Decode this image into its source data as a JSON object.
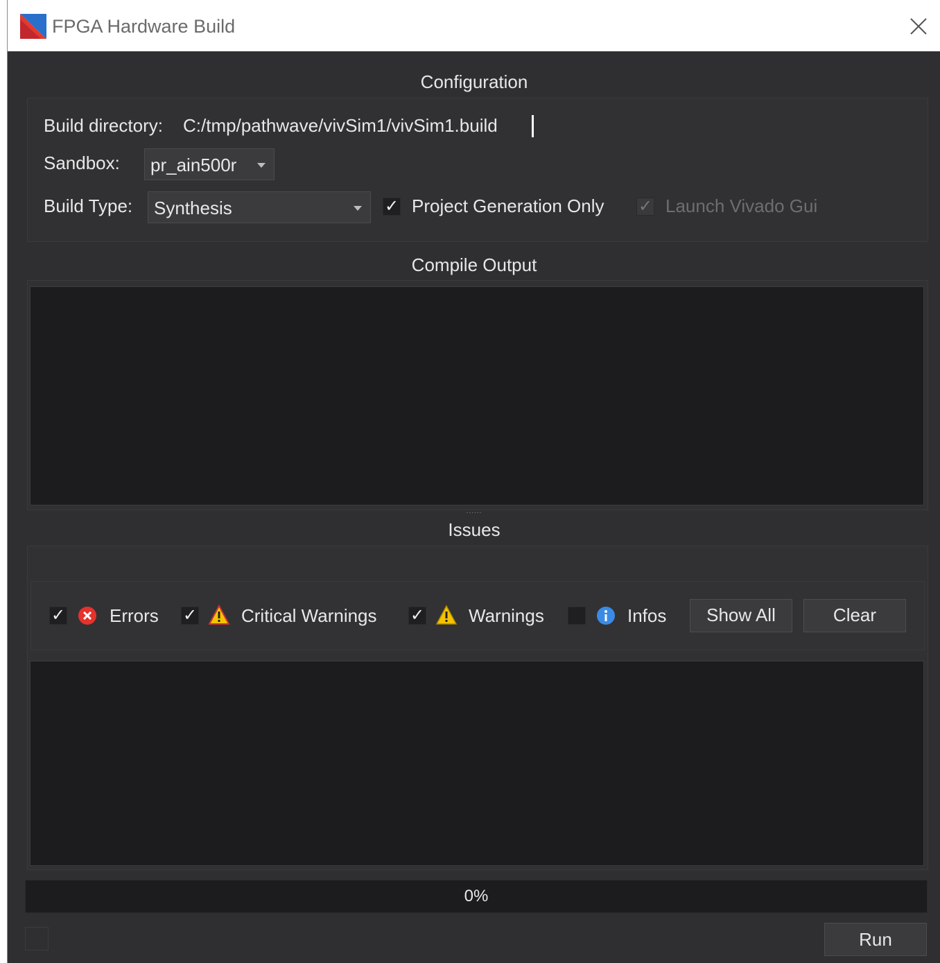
{
  "window": {
    "title": "FPGA Hardware Build"
  },
  "configuration": {
    "heading": "Configuration",
    "build_directory_label": "Build directory:",
    "build_directory_value": "C:/tmp/pathwave/vivSim1/vivSim1.build",
    "sandbox_label": "Sandbox:",
    "sandbox_value": "pr_ain500r",
    "build_type_label": "Build Type:",
    "build_type_value": "Synthesis",
    "project_generation_only": {
      "label": "Project Generation Only",
      "checked": true
    },
    "launch_vivado_gui": {
      "label": "Launch Vivado Gui",
      "checked": true,
      "enabled": false
    }
  },
  "compile_output": {
    "heading": "Compile Output",
    "splitter_grip": "......"
  },
  "issues": {
    "heading": "Issues",
    "filters": [
      {
        "label": "Errors",
        "checked": true,
        "icon": "error-icon"
      },
      {
        "label": "Critical Warnings",
        "checked": true,
        "icon": "critical-warning-icon"
      },
      {
        "label": "Warnings",
        "checked": true,
        "icon": "warning-icon"
      },
      {
        "label": "Infos",
        "checked": false,
        "icon": "info-icon"
      }
    ],
    "show_all_label": "Show All",
    "clear_label": "Clear"
  },
  "progress": {
    "value": 0,
    "text": "0%"
  },
  "run_label": "Run",
  "colors": {
    "error": "#e5322d",
    "warning": "#f5c400",
    "info": "#3b8be6",
    "background": "#2f2f31",
    "panel": "#1c1c1e"
  }
}
